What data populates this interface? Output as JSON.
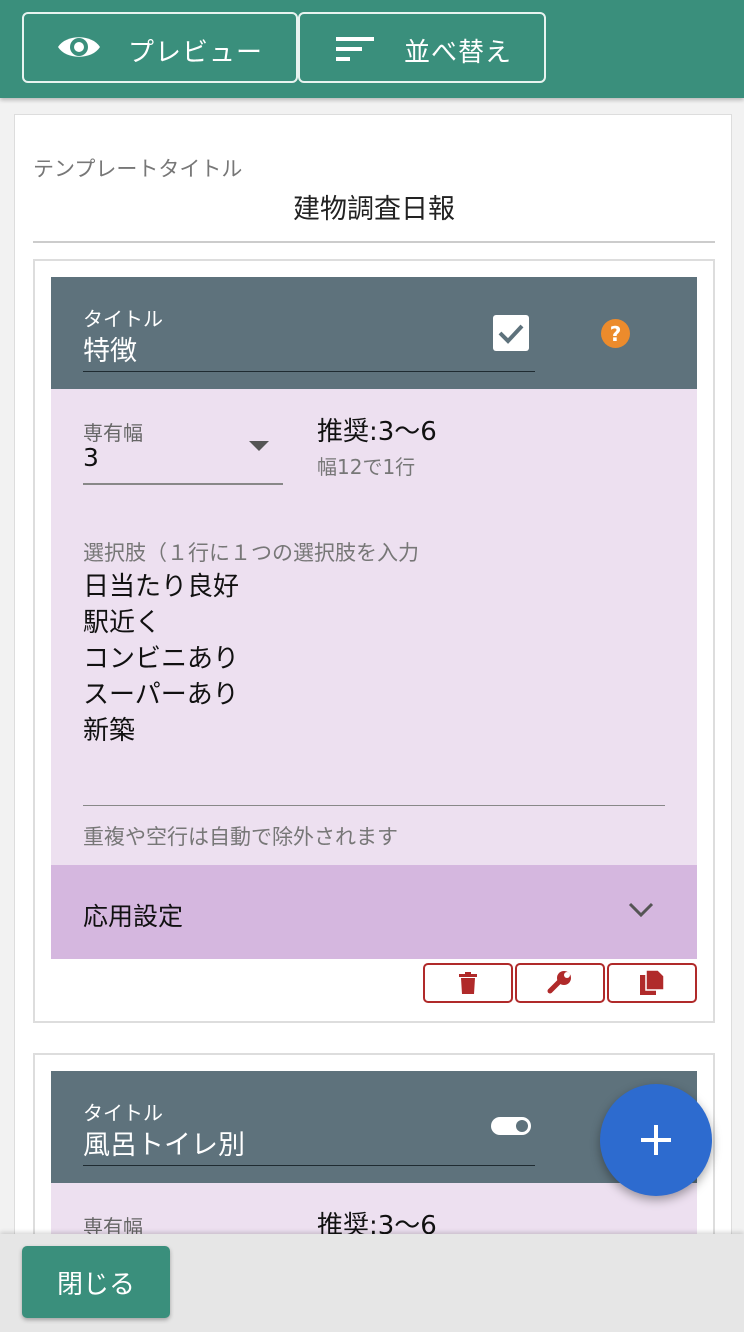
{
  "toolbar": {
    "preview_label": "プレビュー",
    "sort_label": "並べ替え"
  },
  "template": {
    "label": "テンプレートタイトル",
    "value": "建物調査日報"
  },
  "cards": [
    {
      "title_label": "タイトル",
      "title_value": "特徴",
      "width_label": "専有幅",
      "width_value": "3",
      "recommend": "推奨:3〜6",
      "recommend_sub": "幅12で1行",
      "choices_label": "選択肢（１行に１つの選択肢を入力",
      "choices": [
        "日当たり良好",
        "駅近く",
        "コンビニあり",
        "スーパーあり",
        "新築"
      ],
      "hint": "重複や空行は自動で除外されます",
      "advanced_label": "応用設定"
    },
    {
      "title_label": "タイトル",
      "title_value": "風呂トイレ別",
      "width_label": "専有幅",
      "recommend": "推奨:3〜6"
    }
  ],
  "footer": {
    "close_label": "閉じる"
  },
  "colors": {
    "primary": "#3a8f7c",
    "card_header": "#5e727c",
    "card_body": "#ede0f0",
    "advanced": "#d5b7df",
    "danger": "#b02a2a",
    "help": "#ec8b2c",
    "fab": "#2d6bcf"
  }
}
